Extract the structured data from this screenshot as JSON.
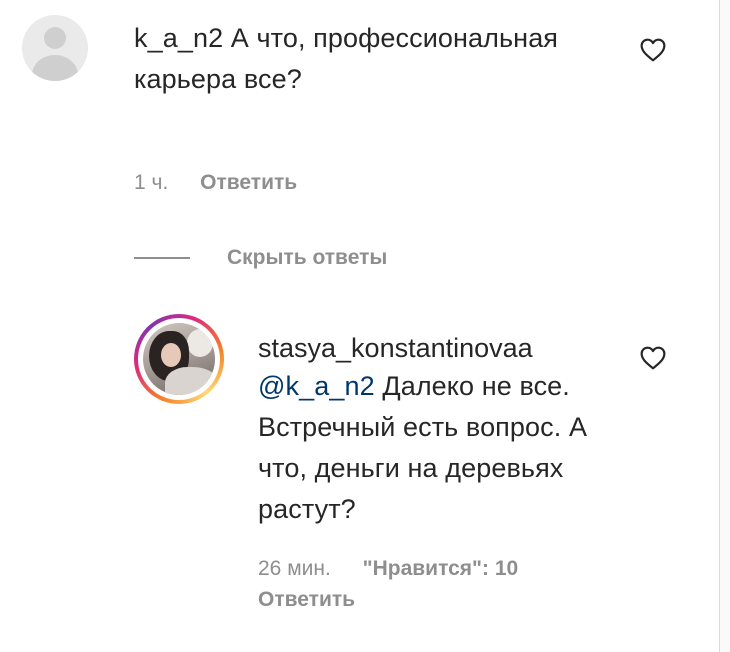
{
  "comment1": {
    "username": "k_a_n2",
    "text": "А что, профессиональная карьера все?",
    "time": "1 ч.",
    "reply_label": "Ответить",
    "avatar_icon": "default-avatar-icon",
    "like_icon": "heart-outline-icon"
  },
  "replies_toggle": {
    "label": "Скрыть ответы"
  },
  "comment2": {
    "username": "stasya_konstantinovaa",
    "mention": "@k_a_n2",
    "text": "Далеко не все. Встречный есть вопрос. А что, деньги на деревьях растут?",
    "time": "26 мин.",
    "likes_label": "\"Нравится\": 10",
    "reply_label": "Ответить",
    "like_icon": "heart-outline-icon",
    "story_ring_colors": [
      "#f58529",
      "#dd2a7b",
      "#8134af",
      "#feda77"
    ]
  },
  "colors": {
    "text_primary": "#262626",
    "text_secondary": "#8e8e8e",
    "mention": "#00376b"
  }
}
